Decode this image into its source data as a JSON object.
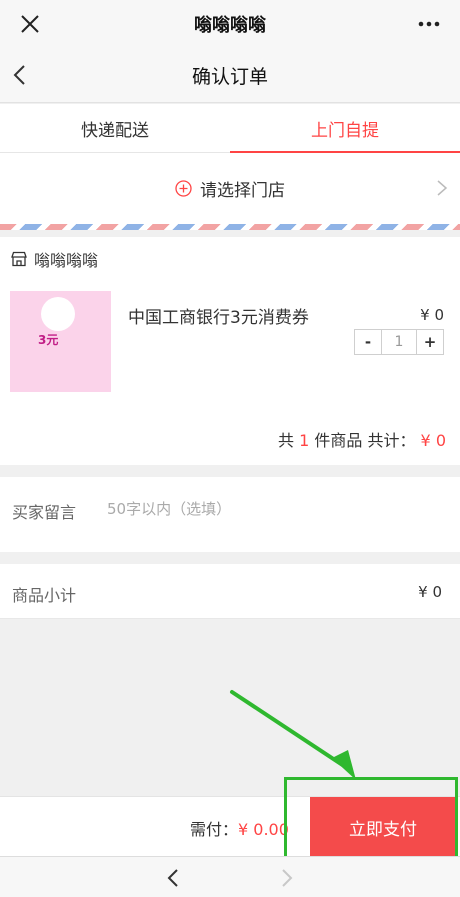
{
  "app": {
    "title": "嗡嗡嗡嗡"
  },
  "page": {
    "title": "确认订单"
  },
  "tabs": [
    {
      "label": "快递配送",
      "active": false
    },
    {
      "label": "上门自提",
      "active": true
    }
  ],
  "store": {
    "select_label": "请选择门店"
  },
  "shop": {
    "name": "嗡嗡嗡嗡",
    "product": {
      "name": "中国工商银行3元消费券",
      "price": "¥ 0",
      "quantity": "1",
      "thumb_amount": "3元"
    },
    "summary": {
      "prefix": "共",
      "count": "1",
      "middle": "件商品 共计：",
      "total": "¥ 0"
    }
  },
  "remark": {
    "label": "买家留言",
    "placeholder": "50字以内（选填）"
  },
  "subtotal": {
    "label": "商品小计",
    "value": "¥ 0"
  },
  "pay": {
    "need_label": "需付：",
    "amount": "¥ 0.00",
    "button_label": "立即支付"
  },
  "colors": {
    "accent": "#f44b4b",
    "annotation": "#2fb82f"
  }
}
